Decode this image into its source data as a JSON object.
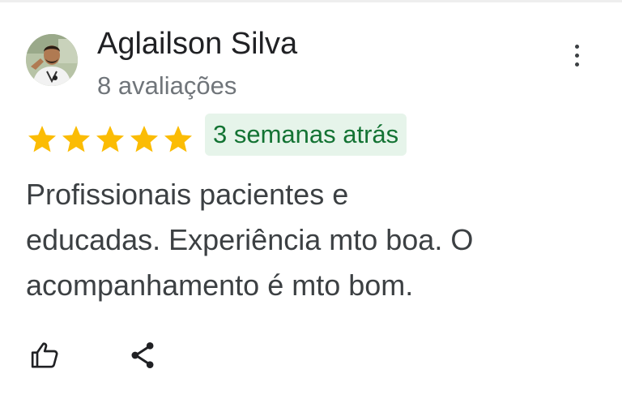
{
  "review": {
    "author_name": "Aglailson Silva",
    "review_count": "8 avaliações",
    "rating": 5,
    "max_rating": 5,
    "date": "3 semanas atrás",
    "text_lines": [
      "Profissionais pacientes e",
      "educadas. Experiência mto boa. O",
      "acompanhamento é mto bom."
    ]
  },
  "icons": {
    "avatar": "user-photo",
    "more": "more-vert-icon",
    "star": "star-icon",
    "like": "thumb-up-icon",
    "share": "share-icon"
  },
  "colors": {
    "star": "#fbbc04",
    "date_badge_bg": "#e6f4ea",
    "date_badge_text": "#137333",
    "name": "#202124",
    "secondary": "#70757a",
    "body": "#3c4043"
  }
}
